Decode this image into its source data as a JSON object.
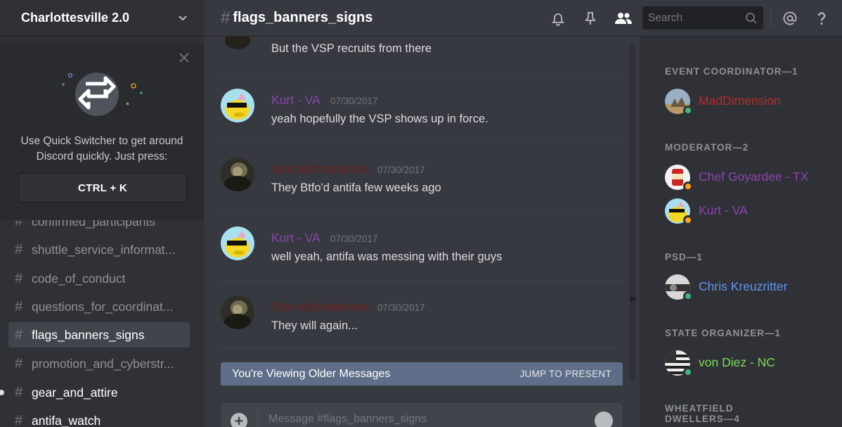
{
  "guild": {
    "name": "Charlottesville 2.0"
  },
  "quick_switcher": {
    "line1": "Use Quick Switcher to get around",
    "line2": "Discord quickly. Just press:",
    "shortcut": "CTRL + K"
  },
  "channels": [
    {
      "name": "confirmed_participants",
      "state": "normal"
    },
    {
      "name": "shuttle_service_informat...",
      "state": "normal"
    },
    {
      "name": "code_of_conduct",
      "state": "normal"
    },
    {
      "name": "questions_for_coordinat...",
      "state": "normal"
    },
    {
      "name": "flags_banners_signs",
      "state": "active"
    },
    {
      "name": "promotion_and_cyberstr...",
      "state": "normal"
    },
    {
      "name": "gear_and_attire",
      "state": "unread"
    },
    {
      "name": "antifa_watch",
      "state": "unread"
    }
  ],
  "header": {
    "hash": "#",
    "channel": "flags_banners_signs",
    "search_placeholder": "Search",
    "icons": [
      "bell-icon",
      "pin-icon",
      "members-icon",
      "search-icon",
      "at-icon",
      "help-icon"
    ]
  },
  "messages": [
    {
      "author": "",
      "color": "",
      "timestamp": "",
      "text": "But the VSP recruits from there",
      "avatar": "soldier"
    },
    {
      "author": "Kurt - VA",
      "color": "#8a44ad",
      "timestamp": "07/30/2017",
      "text": "yeah hopefully the VSP shows up in force.",
      "avatar": "yellow"
    },
    {
      "author": "Stannisthemannis",
      "color": "#6b1f1f",
      "timestamp": "07/30/2017",
      "text": "They Btfo'd antifa few weeks ago",
      "avatar": "soldier"
    },
    {
      "author": "Kurt - VA",
      "color": "#8a44ad",
      "timestamp": "07/30/2017",
      "text": "well yeah, antifa was messing with their guys",
      "avatar": "yellow"
    },
    {
      "author": "Stannisthemannis",
      "color": "#6b1f1f",
      "timestamp": "07/30/2017",
      "text": "They will again...",
      "avatar": "soldier"
    }
  ],
  "older_bar": {
    "label": "You're Viewing Older Messages",
    "action": "JUMP TO PRESENT"
  },
  "composer": {
    "placeholder": "Message #flags_banners_signs"
  },
  "members": [
    {
      "role": "EVENT COORDINATOR—1",
      "users": [
        {
          "name": "MadDimension",
          "color": "#b32d2d",
          "status": "online",
          "avatar": "desert"
        }
      ]
    },
    {
      "role": "MODERATOR—2",
      "users": [
        {
          "name": "Chef Goyardee - TX",
          "color": "#8a44ad",
          "status": "idle",
          "avatar": "can"
        },
        {
          "name": "Kurt - VA",
          "color": "#8a44ad",
          "status": "idle",
          "avatar": "yellow"
        }
      ]
    },
    {
      "role": "PSD—1",
      "users": [
        {
          "name": "Chris Kreuzritter",
          "color": "#6495ed",
          "status": "online",
          "avatar": "bw"
        }
      ]
    },
    {
      "role": "STATE ORGANIZER—1",
      "users": [
        {
          "name": "von Diez - NC",
          "color": "#7ed957",
          "status": "online",
          "avatar": "flag"
        }
      ]
    },
    {
      "role": "WHEATFIELD DWELLERS—4",
      "users": []
    }
  ],
  "colors": {
    "online": "#43b581",
    "idle": "#faa61a",
    "bg": "#36393f",
    "sidebar": "#2f3136"
  }
}
